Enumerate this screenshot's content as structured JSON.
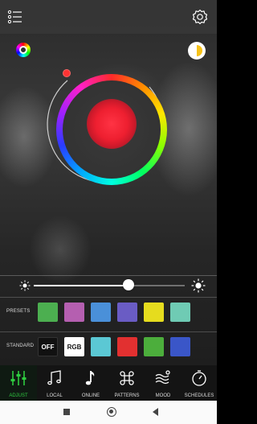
{
  "top_bar": {
    "menu_icon": "list-menu-icon",
    "settings_icon": "gear-icon"
  },
  "color_modes": {
    "rgb_icon": "color-wheel-icon",
    "white_icon": "white-temperature-icon"
  },
  "color_wheel": {
    "selected_color": "#ee1f30"
  },
  "brightness": {
    "level": 0.63,
    "low_icon": "sun-small-icon",
    "high_icon": "sun-large-icon"
  },
  "presets": {
    "label": "PRESETS",
    "colors": [
      "#4caf50",
      "#b55fb0",
      "#4a90d9",
      "#6a5cc4",
      "#e6dc1e",
      "#6fcbb4"
    ]
  },
  "standard": {
    "label": "STANDARD",
    "off_label": "OFF",
    "rgb_label": "RGB",
    "colors": [
      "#5bc8d4",
      "#e23030",
      "#4cae3c",
      "#3a56c8"
    ]
  },
  "tabs": [
    {
      "label": "ADJUST",
      "icon": "sliders-icon",
      "active": true
    },
    {
      "label": "LOCAL",
      "icon": "music-notes-icon",
      "active": false
    },
    {
      "label": "ONLINE",
      "icon": "music-note-icon",
      "active": false
    },
    {
      "label": "PATTERNS",
      "icon": "command-icon",
      "active": false
    },
    {
      "label": "MOOD",
      "icon": "wind-mood-icon",
      "active": false
    },
    {
      "label": "SCHEDULES",
      "icon": "timer-icon",
      "active": false
    }
  ],
  "nav": {
    "recents_icon": "square-icon",
    "home_icon": "circle-icon",
    "back_icon": "triangle-back-icon"
  },
  "colors": {
    "accent": "#2ecc40",
    "topbar": "#373737"
  }
}
